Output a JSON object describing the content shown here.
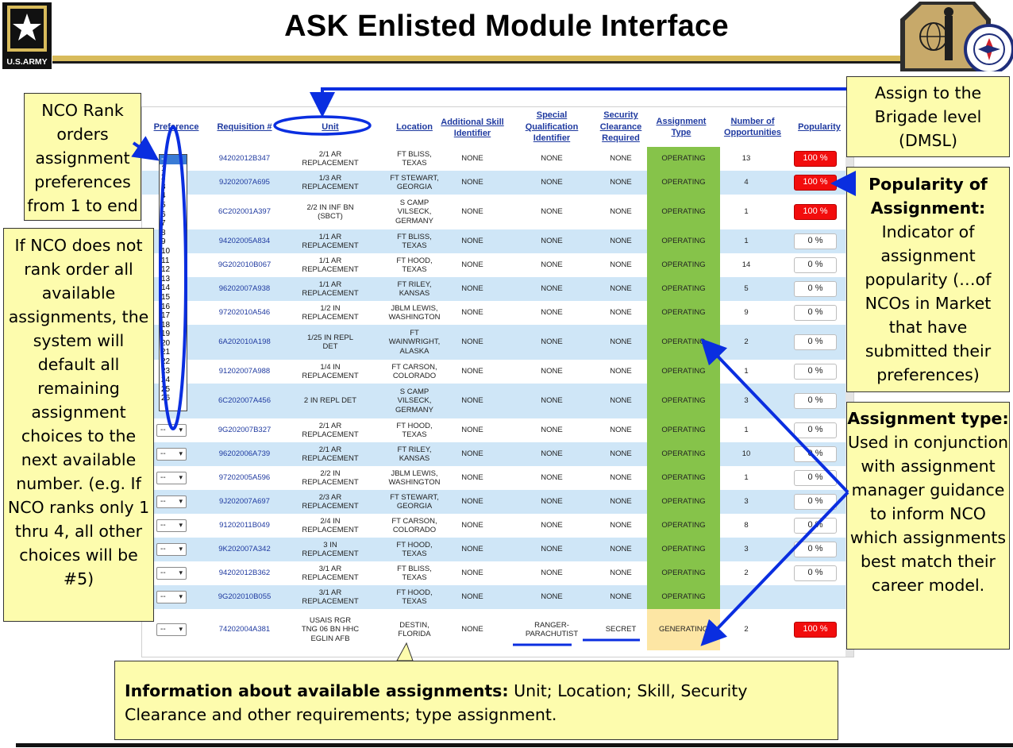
{
  "header": {
    "title": "ASK Enlisted Module Interface",
    "left_logo_text": "U.S.ARMY"
  },
  "table": {
    "headers": {
      "preference": "Preference",
      "requisition": "Requisition #",
      "unit": "Unit",
      "location": "Location",
      "asi": "Additional Skill Identifier",
      "sqi": "Special Qualification Identifier",
      "security": "Security Clearance Required",
      "assignment_type": "Assignment Type",
      "opportunities": "Number of Opportunities",
      "popularity": "Popularity"
    },
    "rows": [
      {
        "pref": "--",
        "req": "94202012B347",
        "unit": "2/1 AR REPLACEMENT",
        "location": "FT BLISS, TEXAS",
        "asi": "NONE",
        "sqi": "NONE",
        "security": "NONE",
        "type": "OPERATING",
        "opps": "13",
        "pop": "100 %"
      },
      {
        "pref": "--",
        "req": "9J202007A695",
        "unit": "1/3 AR REPLACEMENT",
        "location": "FT STEWART, GEORGIA",
        "asi": "NONE",
        "sqi": "NONE",
        "security": "NONE",
        "type": "OPERATING",
        "opps": "4",
        "pop": "100 %"
      },
      {
        "pref": "--",
        "req": "6C202001A397",
        "unit": "2/2 IN INF BN (SBCT)",
        "location": "S CAMP VILSECK, GERMANY",
        "asi": "NONE",
        "sqi": "NONE",
        "security": "NONE",
        "type": "OPERATING",
        "opps": "1",
        "pop": "100 %"
      },
      {
        "pref": "--",
        "req": "94202005A834",
        "unit": "1/1 AR REPLACEMENT",
        "location": "FT BLISS, TEXAS",
        "asi": "NONE",
        "sqi": "NONE",
        "security": "NONE",
        "type": "OPERATING",
        "opps": "1",
        "pop": "0 %"
      },
      {
        "pref": "--",
        "req": "9G202010B067",
        "unit": "1/1 AR REPLACEMENT",
        "location": "FT HOOD, TEXAS",
        "asi": "NONE",
        "sqi": "NONE",
        "security": "NONE",
        "type": "OPERATING",
        "opps": "14",
        "pop": "0 %"
      },
      {
        "pref": "--",
        "req": "96202007A938",
        "unit": "1/1 AR REPLACEMENT",
        "location": "FT RILEY, KANSAS",
        "asi": "NONE",
        "sqi": "NONE",
        "security": "NONE",
        "type": "OPERATING",
        "opps": "5",
        "pop": "0 %"
      },
      {
        "pref": "--",
        "req": "97202010A546",
        "unit": "1/2 IN REPLACEMENT",
        "location": "JBLM LEWIS, WASHINGTON",
        "asi": "NONE",
        "sqi": "NONE",
        "security": "NONE",
        "type": "OPERATING",
        "opps": "9",
        "pop": "0 %"
      },
      {
        "pref": "--",
        "req": "6A202010A198",
        "unit": "1/25 IN REPL DET",
        "location": "FT WAINWRIGHT, ALASKA",
        "asi": "NONE",
        "sqi": "NONE",
        "security": "NONE",
        "type": "OPERATING",
        "opps": "2",
        "pop": "0 %"
      },
      {
        "pref": "--",
        "req": "91202007A988",
        "unit": "1/4 IN REPLACEMENT",
        "location": "FT CARSON, COLORADO",
        "asi": "NONE",
        "sqi": "NONE",
        "security": "NONE",
        "type": "OPERATING",
        "opps": "1",
        "pop": "0 %"
      },
      {
        "pref": "--",
        "req": "6C202007A456",
        "unit": "2 IN REPL DET",
        "location": "S CAMP VILSECK, GERMANY",
        "asi": "NONE",
        "sqi": "NONE",
        "security": "NONE",
        "type": "OPERATING",
        "opps": "3",
        "pop": "0 %"
      },
      {
        "pref": "--",
        "req": "9G202007B327",
        "unit": "2/1 AR REPLACEMENT",
        "location": "FT HOOD, TEXAS",
        "asi": "NONE",
        "sqi": "NONE",
        "security": "NONE",
        "type": "OPERATING",
        "opps": "1",
        "pop": "0 %"
      },
      {
        "pref": "--",
        "req": "96202006A739",
        "unit": "2/1 AR REPLACEMENT",
        "location": "FT RILEY, KANSAS",
        "asi": "NONE",
        "sqi": "NONE",
        "security": "NONE",
        "type": "OPERATING",
        "opps": "10",
        "pop": "0 %"
      },
      {
        "pref": "--",
        "req": "97202005A596",
        "unit": "2/2 IN REPLACEMENT",
        "location": "JBLM LEWIS, WASHINGTON",
        "asi": "NONE",
        "sqi": "NONE",
        "security": "NONE",
        "type": "OPERATING",
        "opps": "1",
        "pop": "0 %"
      },
      {
        "pref": "--",
        "req": "9J202007A697",
        "unit": "2/3 AR REPLACEMENT",
        "location": "FT STEWART, GEORGIA",
        "asi": "NONE",
        "sqi": "NONE",
        "security": "NONE",
        "type": "OPERATING",
        "opps": "3",
        "pop": "0 %"
      },
      {
        "pref": "--",
        "req": "91202011B049",
        "unit": "2/4 IN REPLACEMENT",
        "location": "FT CARSON, COLORADO",
        "asi": "NONE",
        "sqi": "NONE",
        "security": "NONE",
        "type": "OPERATING",
        "opps": "8",
        "pop": "0 %"
      },
      {
        "pref": "--",
        "req": "9K202007A342",
        "unit": "3 IN REPLACEMENT",
        "location": "FT HOOD, TEXAS",
        "asi": "NONE",
        "sqi": "NONE",
        "security": "NONE",
        "type": "OPERATING",
        "opps": "3",
        "pop": "0 %"
      },
      {
        "pref": "--",
        "req": "94202012B362",
        "unit": "3/1 AR REPLACEMENT",
        "location": "FT BLISS, TEXAS",
        "asi": "NONE",
        "sqi": "NONE",
        "security": "NONE",
        "type": "OPERATING",
        "opps": "2",
        "pop": "0 %"
      },
      {
        "pref": "--",
        "req": "9G202010B055",
        "unit": "3/1 AR REPLACEMENT",
        "location": "FT HOOD, TEXAS",
        "asi": "NONE",
        "sqi": "NONE",
        "security": "NONE",
        "type": "OPERATING",
        "opps": "",
        "pop": ""
      },
      {
        "pref": "--",
        "req": "74202004A381",
        "unit": "USAIS RGR TNG 06 BN HHC EGLIN AFB",
        "location": "DESTIN, FLORIDA",
        "asi": "NONE",
        "sqi": "RANGER-PARACHUTIST",
        "security": "SECRET",
        "type": "GENERATING",
        "opps": "2",
        "pop": "100 %"
      }
    ],
    "preference_options": [
      "--",
      "1",
      "2",
      "3",
      "4",
      "5",
      "6",
      "7",
      "8",
      "9",
      "10",
      "11",
      "12",
      "13",
      "14",
      "15",
      "16",
      "17",
      "18",
      "19",
      "20",
      "21",
      "22",
      "23",
      "24",
      "25",
      "26"
    ]
  },
  "callouts": {
    "rank": "NCO Rank orders assignment preferences from 1 to end",
    "default": "If NCO does not rank order all available assignments, the system will default all remaining assignment choices to the next available number. (e.g. If NCO ranks only 1 thru 4, all other choices will be #5)",
    "brigade": "Assign to the Brigade level (DMSL)",
    "popularity_title": "Popularity of Assignment:",
    "popularity_body": "Indicator of assignment popularity (…of NCOs in Market that have submitted their preferences)",
    "type_title": "Assignment type:",
    "type_body": "Used in conjunction with assignment manager guidance to inform NCO which assignments best match their career model.",
    "info_title": "Information about available assignments:",
    "info_body": " Unit; Location; Skill, Security Clearance and other requirements; type assignment."
  },
  "colors": {
    "header_link": "#1f3aa0",
    "row_alt": "#cfe6f7",
    "operating": "#86c34a",
    "generating": "#fde6a4",
    "popularity_high": "#f20d0d",
    "callout_bg": "#fdfcad",
    "arrow_blue": "#0a2ee0"
  }
}
